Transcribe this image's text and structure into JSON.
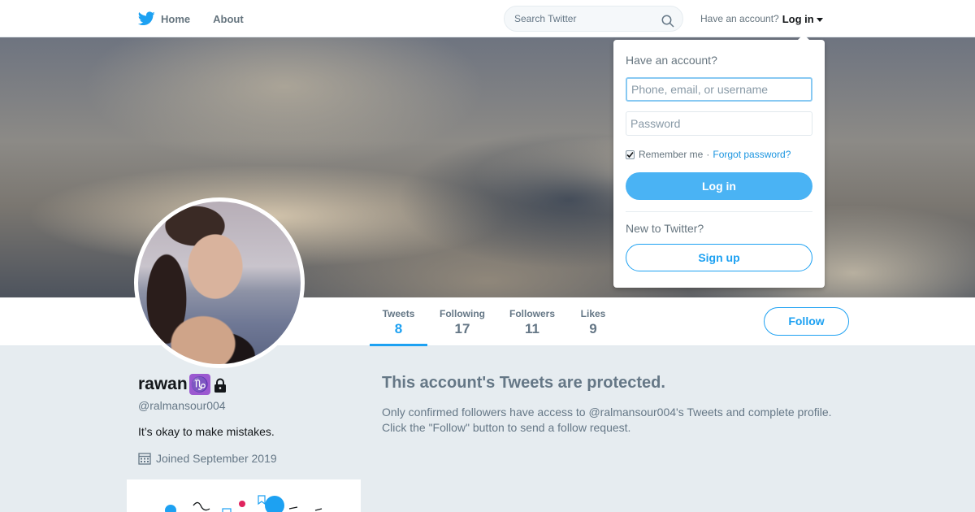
{
  "nav": {
    "home_label": "Home",
    "about_label": "About",
    "search_placeholder": "Search Twitter",
    "have_account_label": "Have an account?",
    "login_label": "Log in"
  },
  "profile": {
    "name": "rawan",
    "zodiac_glyph": "♑",
    "screen_name": "@ralmansour004",
    "bio": "It’s okay to make mistakes.",
    "joined": "Joined September 2019"
  },
  "stats": [
    {
      "label": "Tweets",
      "value": "8",
      "active": true
    },
    {
      "label": "Following",
      "value": "17",
      "active": false
    },
    {
      "label": "Followers",
      "value": "11",
      "active": false
    },
    {
      "label": "Likes",
      "value": "9",
      "active": false
    }
  ],
  "follow_label": "Follow",
  "protected": {
    "title": "This account's Tweets are protected.",
    "line1": "Only confirmed followers have access to @ralmansour004's Tweets and complete profile.",
    "line2": "Click the \"Follow\" button to send a follow request."
  },
  "login_dropdown": {
    "heading": "Have an account?",
    "username_placeholder": "Phone, email, or username",
    "password_placeholder": "Password",
    "remember_label": "Remember me",
    "separator": "·",
    "forgot_label": "Forgot password?",
    "login_button": "Log in",
    "new_label": "New to Twitter?",
    "signup_button": "Sign up"
  },
  "colors": {
    "brand_blue": "#1da1f2",
    "login_button_blue": "#4ab3f4",
    "zodiac_purple": "#9b59d0"
  }
}
